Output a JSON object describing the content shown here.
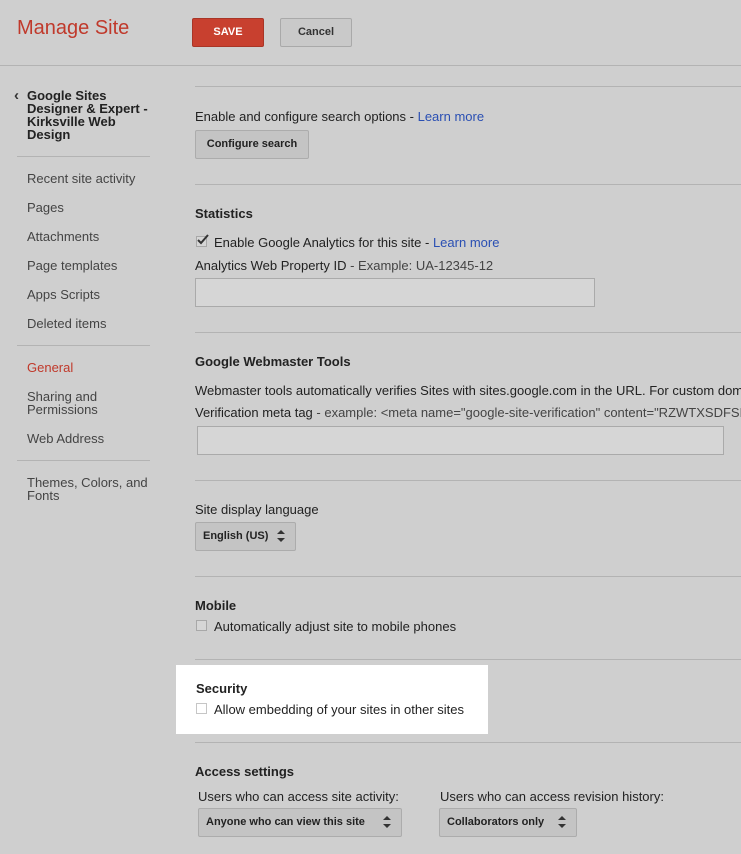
{
  "header": {
    "title": "Manage Site",
    "save_label": "SAVE",
    "cancel_label": "Cancel"
  },
  "sidebar": {
    "site_name": "Google Sites Designer & Expert - Kirksville Web Design",
    "items": [
      {
        "label": "Recent site activity"
      },
      {
        "label": "Pages"
      },
      {
        "label": "Attachments"
      },
      {
        "label": "Page templates"
      },
      {
        "label": "Apps Scripts"
      },
      {
        "label": "Deleted items"
      },
      {
        "label": "General",
        "active": true
      },
      {
        "label": "Sharing and Permissions"
      },
      {
        "label": "Web Address"
      },
      {
        "label": "Themes, Colors, and Fonts"
      }
    ]
  },
  "search": {
    "text": "Enable and configure search options - ",
    "learn_more": "Learn more",
    "button": "Configure search"
  },
  "statistics": {
    "heading": "Statistics",
    "checkbox_label": "Enable Google Analytics for this site - ",
    "checkbox_checked": true,
    "learn_more": "Learn more",
    "property_label": "Analytics Web Property ID",
    "property_example": " - Example: UA-12345-12",
    "property_value": ""
  },
  "webmaster": {
    "heading": "Google Webmaster Tools",
    "description": "Webmaster tools automatically verifies Sites with sites.google.com in the URL. For custom domains",
    "meta_label": "Verification meta tag",
    "meta_example": " - example: <meta name=\"google-site-verification\" content=\"RZWTXSDFSKD",
    "meta_value": ""
  },
  "language": {
    "label": "Site display language",
    "selected": "English (US)"
  },
  "mobile": {
    "heading": "Mobile",
    "checkbox_label": "Automatically adjust site to mobile phones",
    "checkbox_checked": false
  },
  "security": {
    "heading": "Security",
    "checkbox_label": "Allow embedding of your sites in other sites",
    "checkbox_checked": false
  },
  "access": {
    "heading": "Access settings",
    "activity_label": "Users who can access site activity:",
    "activity_selected": "Anyone who can view this site",
    "revision_label": "Users who can access revision history:",
    "revision_selected": "Collaborators only"
  },
  "colors": {
    "accent": "#c0392b",
    "link": "#2a4fb3",
    "background": "#cfcfcf"
  }
}
